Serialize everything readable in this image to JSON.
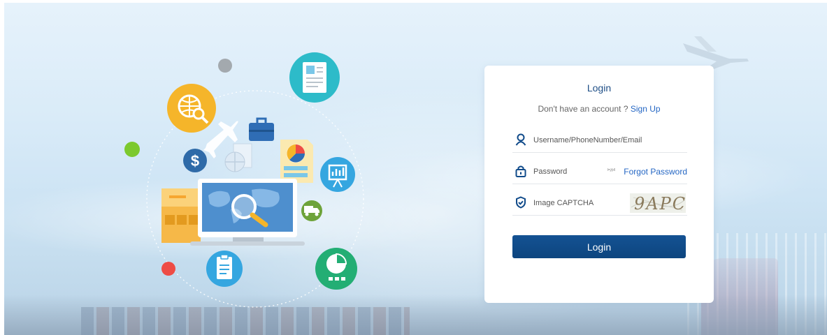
{
  "login": {
    "title": "Login",
    "signup_prompt": "Don't have an account ? ",
    "signup_link": "Sign Up",
    "username_placeholder": "Username/PhoneNumber/Email",
    "password_placeholder": "Password",
    "password_toggle": "Þýþ¢",
    "forgot_password": "Forgot Password",
    "captcha_placeholder": "Image CAPTCHA",
    "captcha_text": "9APC",
    "submit_label": "Login"
  },
  "colors": {
    "primary": "#0f4a87",
    "link": "#2567c4",
    "title": "#1e4e86"
  },
  "icons": {
    "username": "user-icon",
    "password": "lock-icon",
    "captcha": "shield-check-icon"
  }
}
